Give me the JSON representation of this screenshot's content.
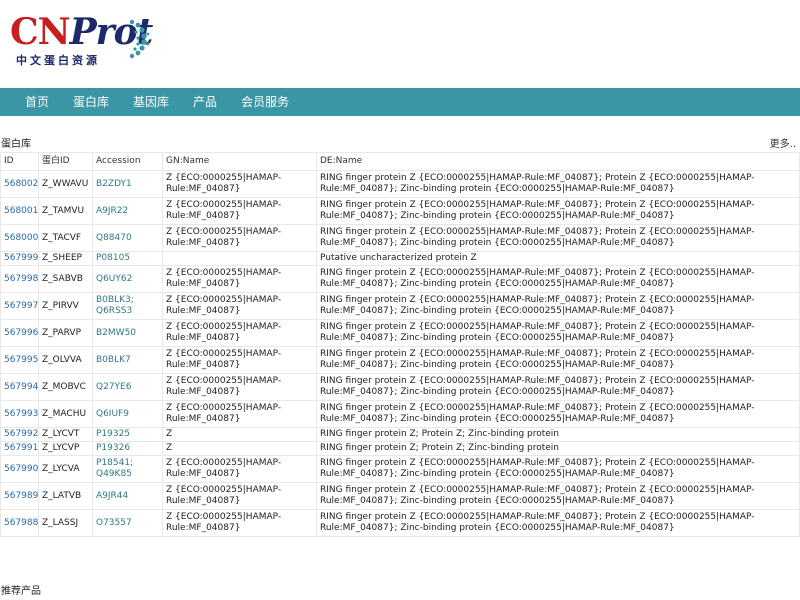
{
  "logo": {
    "part1": "CN",
    "part2": "Prot",
    "subtitle": "中文蛋白资源"
  },
  "nav": {
    "items": [
      "首页",
      "蛋白库",
      "基因库",
      "产品",
      "会员服务"
    ]
  },
  "section": {
    "title": "蛋白库",
    "more": "更多.."
  },
  "table": {
    "headers": [
      "ID",
      "蛋白ID",
      "Accession",
      "GN:Name",
      "DE:Name"
    ],
    "rows": [
      {
        "id": "568002",
        "pid": "Z_WWAVU",
        "acc": "B2ZDY1",
        "gn": "Z {ECO:0000255|HAMAP-Rule:MF_04087}",
        "de": "RING finger protein Z {ECO:0000255|HAMAP-Rule:MF_04087}; Protein Z {ECO:0000255|HAMAP-Rule:MF_04087}; Zinc-binding protein {ECO:0000255|HAMAP-Rule:MF_04087}"
      },
      {
        "id": "568001",
        "pid": "Z_TAMVU",
        "acc": "A9JR22",
        "gn": "Z {ECO:0000255|HAMAP-Rule:MF_04087}",
        "de": "RING finger protein Z {ECO:0000255|HAMAP-Rule:MF_04087}; Protein Z {ECO:0000255|HAMAP-Rule:MF_04087}; Zinc-binding protein {ECO:0000255|HAMAP-Rule:MF_04087}"
      },
      {
        "id": "568000",
        "pid": "Z_TACVF",
        "acc": "Q88470",
        "gn": "Z {ECO:0000255|HAMAP-Rule:MF_04087}",
        "de": "RING finger protein Z {ECO:0000255|HAMAP-Rule:MF_04087}; Protein Z {ECO:0000255|HAMAP-Rule:MF_04087}; Zinc-binding protein {ECO:0000255|HAMAP-Rule:MF_04087}"
      },
      {
        "id": "567999",
        "pid": "Z_SHEEP",
        "acc": "P08105",
        "gn": "",
        "de": "Putative uncharacterized protein Z"
      },
      {
        "id": "567998",
        "pid": "Z_SABVB",
        "acc": "Q6UY62",
        "gn": "Z {ECO:0000255|HAMAP-Rule:MF_04087}",
        "de": "RING finger protein Z {ECO:0000255|HAMAP-Rule:MF_04087}; Protein Z {ECO:0000255|HAMAP-Rule:MF_04087}; Zinc-binding protein {ECO:0000255|HAMAP-Rule:MF_04087}"
      },
      {
        "id": "567997",
        "pid": "Z_PIRVV",
        "acc": "B0BLK3; Q6RSS3",
        "gn": "Z {ECO:0000255|HAMAP-Rule:MF_04087}",
        "de": "RING finger protein Z {ECO:0000255|HAMAP-Rule:MF_04087}; Protein Z {ECO:0000255|HAMAP-Rule:MF_04087}; Zinc-binding protein {ECO:0000255|HAMAP-Rule:MF_04087}"
      },
      {
        "id": "567996",
        "pid": "Z_PARVP",
        "acc": "B2MW50",
        "gn": "Z {ECO:0000255|HAMAP-Rule:MF_04087}",
        "de": "RING finger protein Z {ECO:0000255|HAMAP-Rule:MF_04087}; Protein Z {ECO:0000255|HAMAP-Rule:MF_04087}; Zinc-binding protein {ECO:0000255|HAMAP-Rule:MF_04087}"
      },
      {
        "id": "567995",
        "pid": "Z_OLVVA",
        "acc": "B0BLK7",
        "gn": "Z {ECO:0000255|HAMAP-Rule:MF_04087}",
        "de": "RING finger protein Z {ECO:0000255|HAMAP-Rule:MF_04087}; Protein Z {ECO:0000255|HAMAP-Rule:MF_04087}; Zinc-binding protein {ECO:0000255|HAMAP-Rule:MF_04087}"
      },
      {
        "id": "567994",
        "pid": "Z_MOBVC",
        "acc": "Q27YE6",
        "gn": "Z {ECO:0000255|HAMAP-Rule:MF_04087}",
        "de": "RING finger protein Z {ECO:0000255|HAMAP-Rule:MF_04087}; Protein Z {ECO:0000255|HAMAP-Rule:MF_04087}; Zinc-binding protein {ECO:0000255|HAMAP-Rule:MF_04087}"
      },
      {
        "id": "567993",
        "pid": "Z_MACHU",
        "acc": "Q6IUF9",
        "gn": "Z {ECO:0000255|HAMAP-Rule:MF_04087}",
        "de": "RING finger protein Z {ECO:0000255|HAMAP-Rule:MF_04087}; Protein Z {ECO:0000255|HAMAP-Rule:MF_04087}; Zinc-binding protein {ECO:0000255|HAMAP-Rule:MF_04087}"
      },
      {
        "id": "567992",
        "pid": "Z_LYCVT",
        "acc": "P19325",
        "gn": "Z",
        "de": "RING finger protein Z; Protein Z; Zinc-binding protein"
      },
      {
        "id": "567991",
        "pid": "Z_LYCVP",
        "acc": "P19326",
        "gn": "Z",
        "de": "RING finger protein Z; Protein Z; Zinc-binding protein"
      },
      {
        "id": "567990",
        "pid": "Z_LYCVA",
        "acc": "P18541; Q49K85",
        "gn": "Z {ECO:0000255|HAMAP-Rule:MF_04087}",
        "de": "RING finger protein Z {ECO:0000255|HAMAP-Rule:MF_04087}; Protein Z {ECO:0000255|HAMAP-Rule:MF_04087}; Zinc-binding protein {ECO:0000255|HAMAP-Rule:MF_04087}"
      },
      {
        "id": "567989",
        "pid": "Z_LATVB",
        "acc": "A9JR44",
        "gn": "Z {ECO:0000255|HAMAP-Rule:MF_04087}",
        "de": "RING finger protein Z {ECO:0000255|HAMAP-Rule:MF_04087}; Protein Z {ECO:0000255|HAMAP-Rule:MF_04087}; Zinc-binding protein {ECO:0000255|HAMAP-Rule:MF_04087}"
      },
      {
        "id": "567988",
        "pid": "Z_LASSJ",
        "acc": "O73557",
        "gn": "Z {ECO:0000255|HAMAP-Rule:MF_04087}",
        "de": "RING finger protein Z {ECO:0000255|HAMAP-Rule:MF_04087}; Protein Z {ECO:0000255|HAMAP-Rule:MF_04087}; Zinc-binding protein {ECO:0000255|HAMAP-Rule:MF_04087}"
      }
    ]
  },
  "recommend": {
    "title": "推荐产品"
  },
  "colors": {
    "nav_bg": "#3a95a5",
    "logo_red": "#c81e1e",
    "logo_navy": "#1c2a6b",
    "link": "#2b6aa6",
    "accession": "#2f7a86"
  }
}
